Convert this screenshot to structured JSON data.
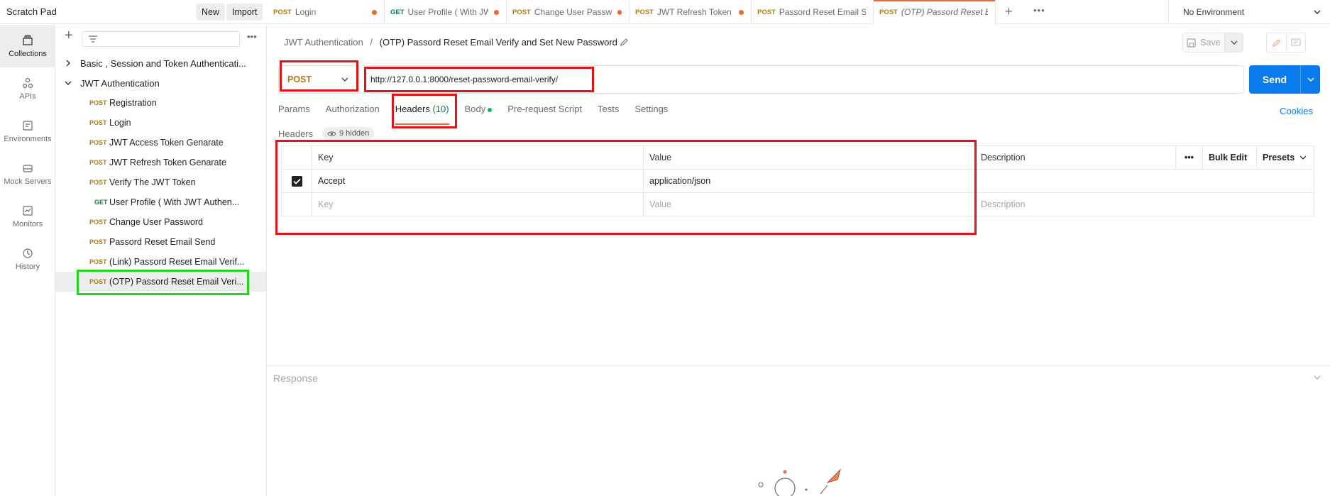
{
  "workspace": {
    "title": "Scratch Pad",
    "new_label": "New",
    "import_label": "Import"
  },
  "tabs": [
    {
      "method": "POST",
      "title": "Login",
      "dirty": true
    },
    {
      "method": "GET",
      "title": "User Profile ( With JWT",
      "dirty": true
    },
    {
      "method": "POST",
      "title": "Change User Passwo",
      "dirty": true
    },
    {
      "method": "POST",
      "title": "JWT Refresh Token G",
      "dirty": true
    },
    {
      "method": "POST",
      "title": "Passord Reset Email Se",
      "dirty": false
    },
    {
      "method": "POST",
      "title": "(OTP) Passord Reset Em",
      "dirty": false,
      "active": true
    }
  ],
  "environment": {
    "label": "No Environment"
  },
  "rail": [
    {
      "label": "Collections",
      "icon": "collections-icon",
      "active": true
    },
    {
      "label": "APIs",
      "icon": "apis-icon"
    },
    {
      "label": "Environments",
      "icon": "environments-icon"
    },
    {
      "label": "Mock Servers",
      "icon": "mock-servers-icon"
    },
    {
      "label": "Monitors",
      "icon": "monitors-icon"
    },
    {
      "label": "History",
      "icon": "history-icon"
    }
  ],
  "sidebar": {
    "collections": [
      {
        "label": "Basic , Session and Token Authenticati...",
        "expanded": false
      },
      {
        "label": "JWT Authentication",
        "expanded": true
      }
    ],
    "requests": [
      {
        "method": "POST",
        "label": "Registration"
      },
      {
        "method": "POST",
        "label": "Login"
      },
      {
        "method": "POST",
        "label": "JWT Access Token Genarate"
      },
      {
        "method": "POST",
        "label": "JWT Refresh Token Genarate"
      },
      {
        "method": "POST",
        "label": "Verify The JWT Token"
      },
      {
        "method": "GET",
        "label": "User Profile ( With JWT Authen..."
      },
      {
        "method": "POST",
        "label": "Change User Password"
      },
      {
        "method": "POST",
        "label": "Passord Reset Email Send"
      },
      {
        "method": "POST",
        "label": "(Link) Passord Reset Email Verif..."
      },
      {
        "method": "POST",
        "label": "(OTP) Passord Reset Email Veri...",
        "selected": true
      }
    ]
  },
  "breadcrumb": {
    "parent": "JWT Authentication",
    "separator": "/",
    "current": "(OTP) Passord Reset Email Verify and Set New Password"
  },
  "toolbar": {
    "save_label": "Save"
  },
  "request": {
    "method": "POST",
    "url": "http://127.0.0.1:8000/reset-password-email-verify/",
    "send_label": "Send"
  },
  "req_tabs": {
    "params": "Params",
    "authorization": "Authorization",
    "headers": "Headers",
    "headers_count": "(10)",
    "body": "Body",
    "prerequest": "Pre-request Script",
    "tests": "Tests",
    "settings": "Settings",
    "cookies": "Cookies"
  },
  "headers_section": {
    "label": "Headers",
    "hidden": "9 hidden",
    "columns": {
      "key": "Key",
      "value": "Value",
      "description": "Description",
      "bulk_edit": "Bulk Edit",
      "presets": "Presets"
    },
    "rows": [
      {
        "checked": true,
        "key": "Accept",
        "value": "application/json",
        "description": ""
      }
    ],
    "placeholder": {
      "key": "Key",
      "value": "Value",
      "description": "Description"
    }
  },
  "response": {
    "label": "Response"
  },
  "colors": {
    "accent": "#eb6b36",
    "send": "#097bed",
    "post": "#b07d14",
    "get": "#0f7b3e",
    "highlight_red": "#e0121a",
    "highlight_green": "#22d61a"
  }
}
